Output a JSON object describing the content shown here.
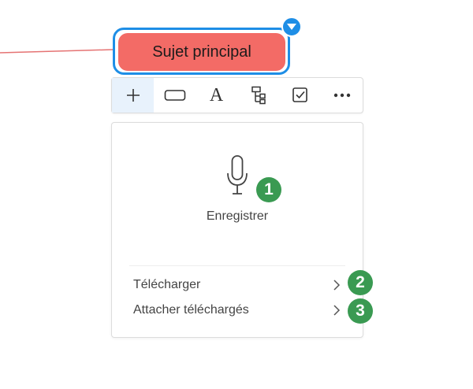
{
  "topic": {
    "label": "Sujet principal",
    "fill_color": "#f36b66",
    "selection_color": "#1e8ee6"
  },
  "toolbar": {
    "buttons": [
      {
        "name": "add",
        "icon": "plus-icon"
      },
      {
        "name": "shape",
        "icon": "rounded-rect-icon"
      },
      {
        "name": "text",
        "icon": "text-style-icon",
        "glyph": "A"
      },
      {
        "name": "structure",
        "icon": "tree-structure-icon"
      },
      {
        "name": "task",
        "icon": "checkbox-icon"
      },
      {
        "name": "more",
        "icon": "more-dots-icon"
      }
    ]
  },
  "panel": {
    "record_label": "Enregistrer",
    "menu": [
      {
        "label": "Télécharger",
        "icon": "chevron-right-icon"
      },
      {
        "label": "Attacher téléchargés",
        "icon": "chevron-right-icon"
      }
    ]
  },
  "badges": [
    "1",
    "2",
    "3"
  ],
  "colors": {
    "badge": "#3a9a52",
    "connector": "#e57373"
  }
}
